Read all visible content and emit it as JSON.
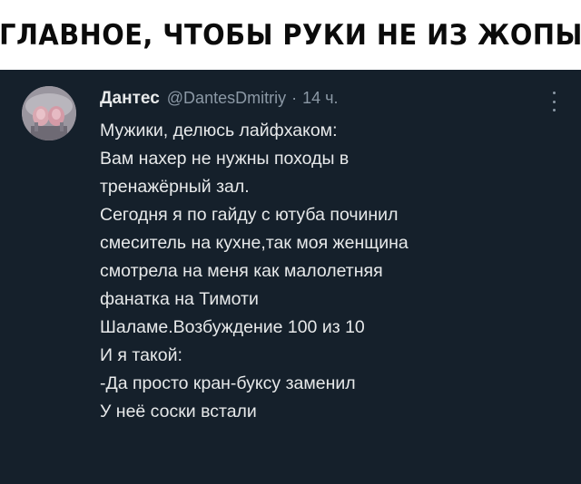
{
  "caption": "ГЛАВНОЕ, ЧТОБЫ РУКИ НЕ ИЗ ЖОПЫ",
  "tweet": {
    "author_name": "Дантес",
    "author_handle": "@DantesDmitriy",
    "separator": "·",
    "time": "14 ч.",
    "more_icon": "more-vertical-icon",
    "lines": [
      "Мужики, делюсь лайфхаком:",
      "Вам нахер не нужны походы в",
      "тренажёрный зал.",
      "Сегодня я по гайду с ютуба починил",
      "смеситель на кухне,так моя женщина",
      "смотрела на меня как малолетняя",
      "фанатка на Тимоти",
      "Шаламе.Возбуждение 100 из 10",
      "И я такой:",
      "-Да просто кран-буксу заменил",
      "У неё соски встали"
    ]
  },
  "colors": {
    "background": "#15202b",
    "text": "#e7e9ea",
    "muted": "#8b98a5"
  }
}
